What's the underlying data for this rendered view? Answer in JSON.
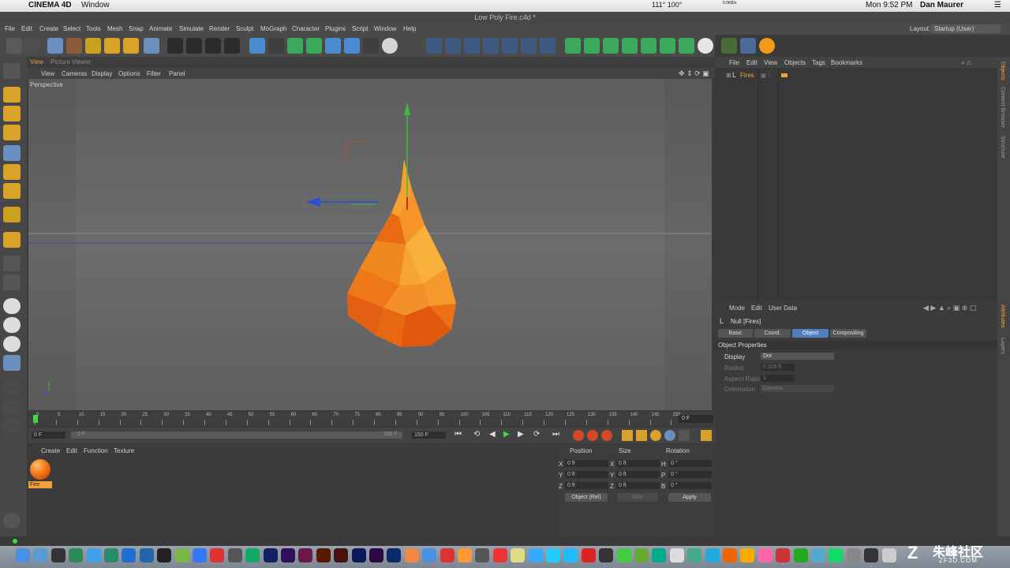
{
  "mac_menubar": {
    "app": "CINEMA 4D",
    "window": "Window",
    "temp": "111° 100°",
    "net": "0.0KB/s",
    "clock": "Mon 9:52 PM",
    "user": "Dan Maurer"
  },
  "title": "Low Poly Fire.c4d *",
  "main_menu": [
    "File",
    "Edit",
    "Create",
    "Select",
    "Tools",
    "Mesh",
    "Snap",
    "Animate",
    "Simulate",
    "Render",
    "Sculpt",
    "MoGraph",
    "Character",
    "Plugins",
    "Script",
    "Window",
    "Help"
  ],
  "layout": {
    "label": "Layout:",
    "value": "Startup (User)"
  },
  "viewport": {
    "tabs": [
      "View",
      "Picture Viewer"
    ],
    "menu": [
      "View",
      "Cameras",
      "Display",
      "Options",
      "Filter",
      "Panel"
    ],
    "camera_label": "Perspective"
  },
  "timeline": {
    "ticks": [
      "0",
      "5",
      "10",
      "15",
      "20",
      "25",
      "30",
      "35",
      "40",
      "45",
      "50",
      "55",
      "60",
      "65",
      "70",
      "75",
      "80",
      "85",
      "90",
      "95",
      "100",
      "105",
      "110",
      "115",
      "120",
      "125",
      "130",
      "135",
      "140",
      "145",
      "150"
    ],
    "frame_display": "0 F",
    "start": "0 F",
    "range_start": "0 F",
    "range_end": "150 F",
    "end": "150 F"
  },
  "material_manager": {
    "menu": [
      "Create",
      "Edit",
      "Function",
      "Texture"
    ],
    "materials": [
      {
        "name": "Fire"
      }
    ]
  },
  "coords": {
    "headers": [
      "Position",
      "Size",
      "Rotation"
    ],
    "rows": [
      {
        "axis": "X",
        "pos": "0 ft",
        "size_axis": "X",
        "size": "0 ft",
        "rot_axis": "H",
        "rot": "0 °"
      },
      {
        "axis": "Y",
        "pos": "0 ft",
        "size_axis": "Y",
        "size": "0 ft",
        "rot_axis": "P",
        "rot": "0 °"
      },
      {
        "axis": "Z",
        "pos": "0 ft",
        "size_axis": "Z",
        "size": "0 ft",
        "rot_axis": "B",
        "rot": "0 °"
      }
    ],
    "mode": "Object (Rel)",
    "size_mode": "Size",
    "apply": "Apply"
  },
  "object_manager": {
    "menu": [
      "File",
      "Edit",
      "View",
      "Objects",
      "Tags",
      "Bookmarks"
    ],
    "objects": [
      {
        "name": "Fires"
      }
    ]
  },
  "attribute_manager": {
    "menu": [
      "Mode",
      "Edit",
      "User Data"
    ],
    "object_title": "Null [Fires]",
    "tabs": [
      "Basic",
      "Coord.",
      "Object",
      "Compositing"
    ],
    "active_tab": "Object",
    "section": "Object Properties",
    "props": [
      {
        "label": "Display",
        "value": "Dot"
      },
      {
        "label": "Radius",
        "value": "0.328 ft"
      },
      {
        "label": "Aspect Ratio",
        "value": "1"
      },
      {
        "label": "Orientation",
        "value": "Camera"
      }
    ]
  },
  "side_tabs": [
    "Objects",
    "Content Browser",
    "Structure"
  ],
  "side_tabs_lower": [
    "Attributes",
    "Layers"
  ],
  "watermark": {
    "brand": "朱峰社区",
    "site": "ZF3D.COM"
  },
  "colors": {
    "accent": "#f2a03a",
    "active_tab": "#4f7fbf",
    "fire_orange": "#f07a1a"
  }
}
